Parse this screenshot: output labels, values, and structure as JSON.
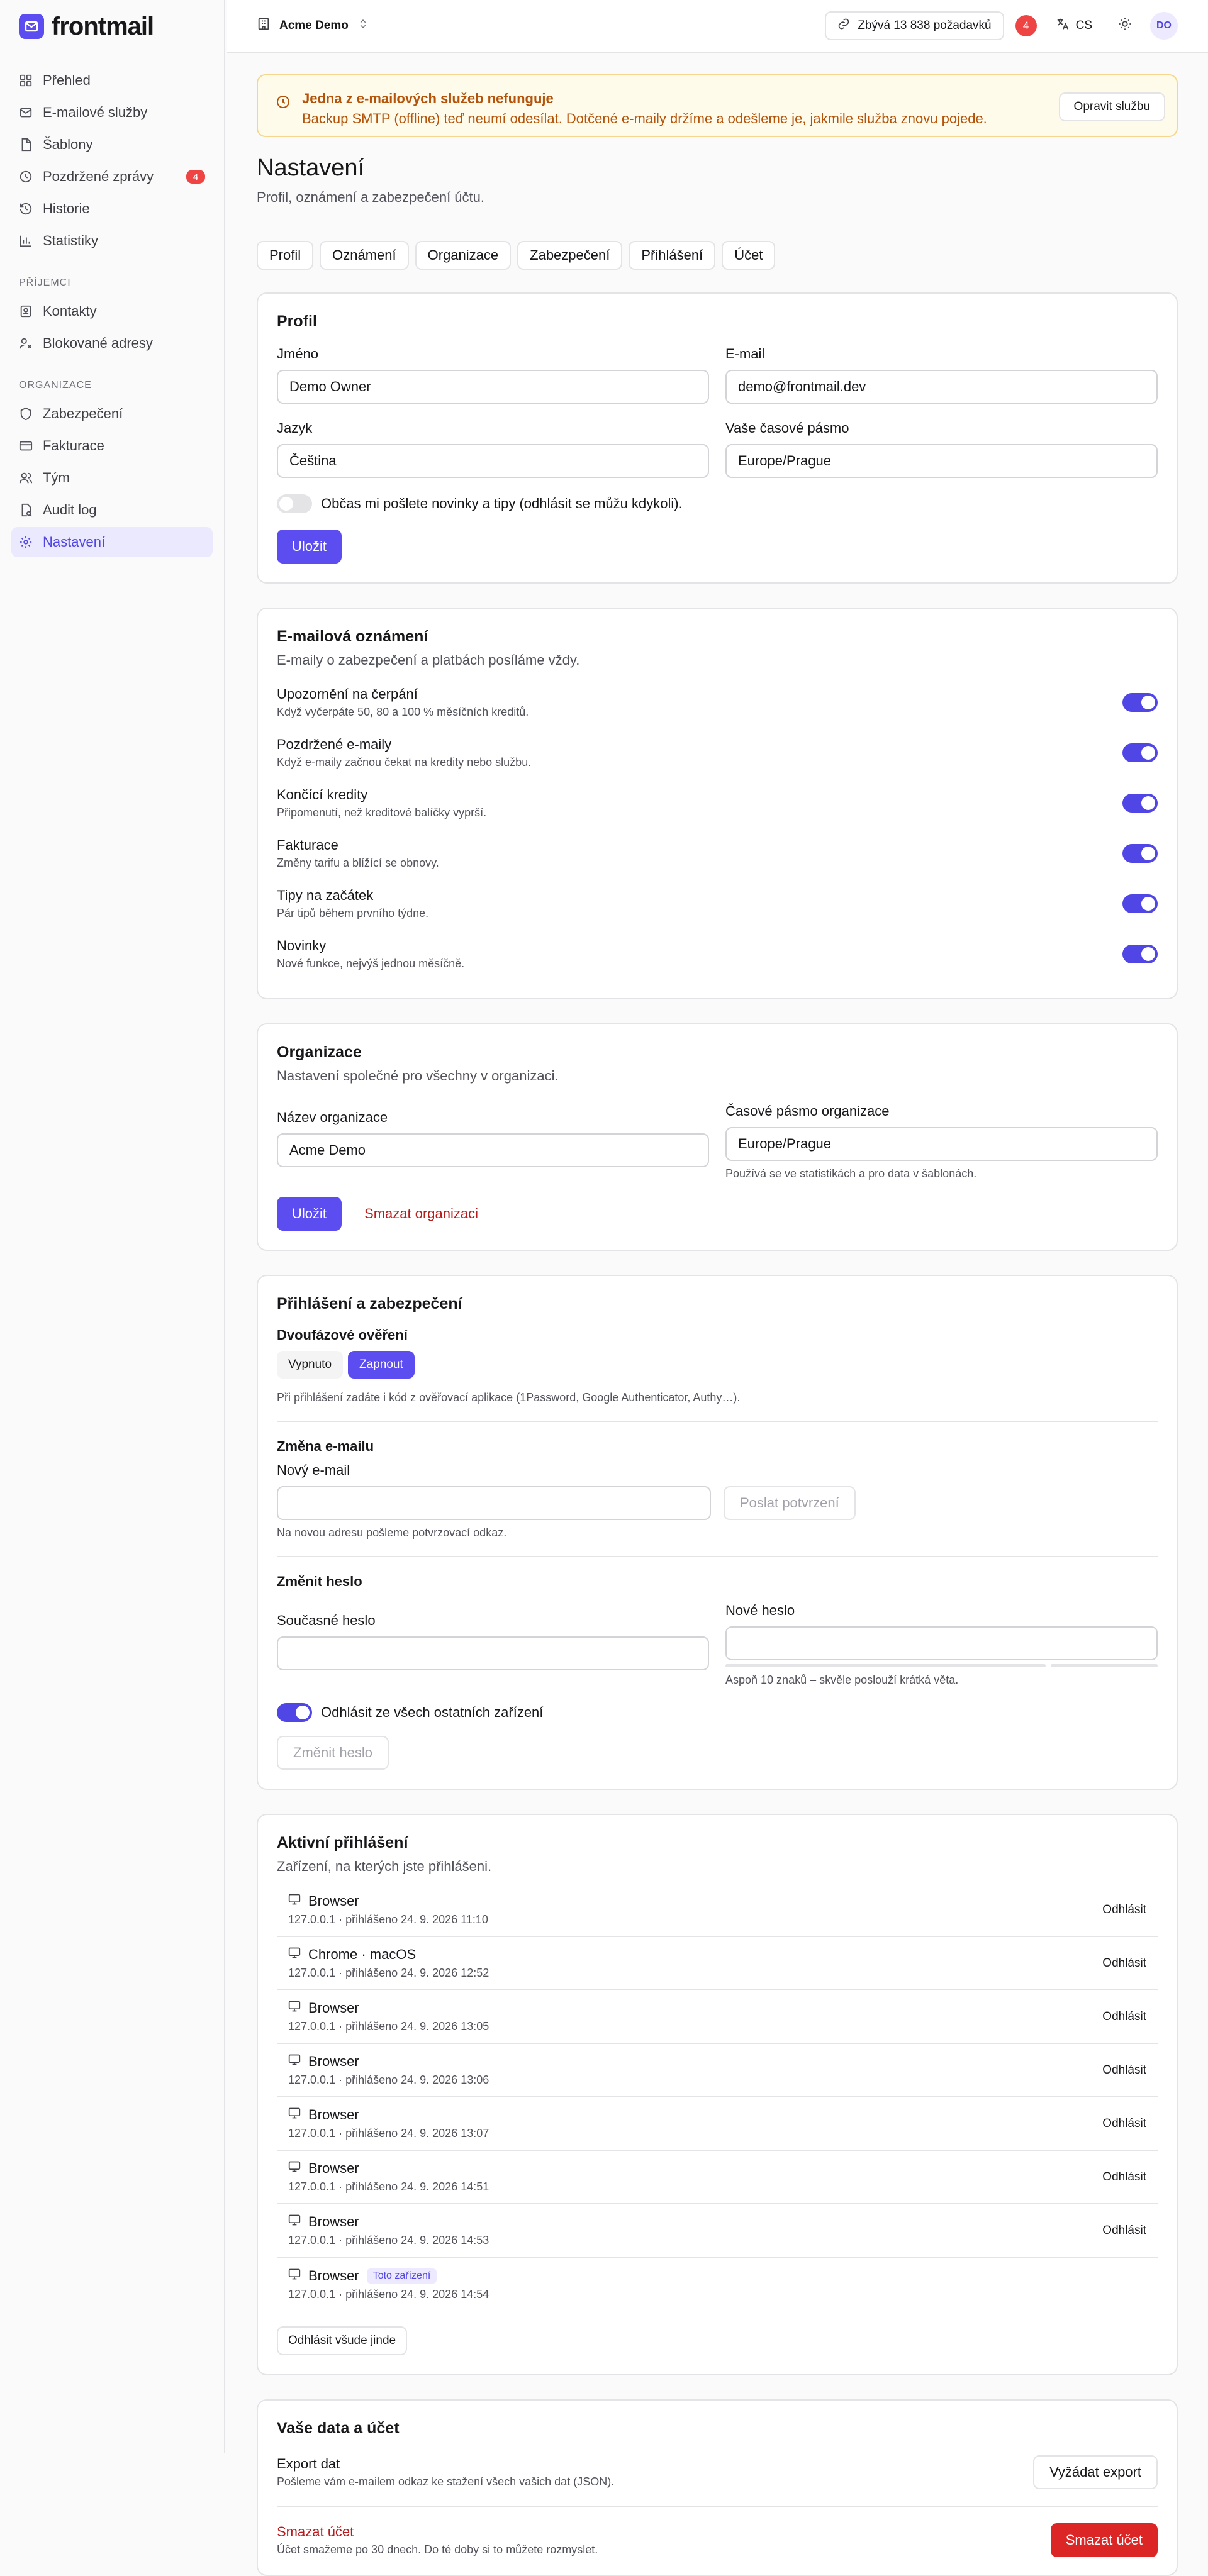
{
  "brand": {
    "name": "frontmail",
    "accent": "#5b4df0"
  },
  "sidebar": {
    "main": [
      {
        "label": "Přehled",
        "icon": "grid-icon"
      },
      {
        "label": "E-mailové služby",
        "icon": "mail-icon"
      },
      {
        "label": "Šablony",
        "icon": "file-icon"
      },
      {
        "label": "Pozdržené zprávy",
        "icon": "clock-icon",
        "badge": "4"
      },
      {
        "label": "Historie",
        "icon": "history-icon"
      },
      {
        "label": "Statistiky",
        "icon": "chart-icon"
      }
    ],
    "recipients_title": "PŘÍJEMCI",
    "recipients": [
      {
        "label": "Kontakty",
        "icon": "contact-icon"
      },
      {
        "label": "Blokované adresy",
        "icon": "user-block-icon"
      }
    ],
    "org_title": "ORGANIZACE",
    "org": [
      {
        "label": "Zabezpečení",
        "icon": "shield-icon"
      },
      {
        "label": "Fakturace",
        "icon": "card-icon"
      },
      {
        "label": "Tým",
        "icon": "team-icon"
      },
      {
        "label": "Audit log",
        "icon": "audit-icon"
      },
      {
        "label": "Nastavení",
        "icon": "gear-icon",
        "active": true
      }
    ]
  },
  "topbar": {
    "org_name": "Acme Demo",
    "quota": "Zbývá 13 838 požadavků",
    "notif_count": "4",
    "lang": "CS",
    "avatar": "DO"
  },
  "alert": {
    "title": "Jedna z e-mailových služeb nefunguje",
    "text": "Backup SMTP (offline) teď neumí odesílat. Dotčené e-maily držíme a odešleme je, jakmile služba znovu pojede.",
    "button": "Opravit službu"
  },
  "page": {
    "title": "Nastavení",
    "subtitle": "Profil, oznámení a zabezpečení účtu."
  },
  "tabs": [
    "Profil",
    "Oznámení",
    "Organizace",
    "Zabezpečení",
    "Přihlášení",
    "Účet"
  ],
  "profile": {
    "title": "Profil",
    "name_label": "Jméno",
    "name_value": "Demo Owner",
    "email_label": "E-mail",
    "email_value": "demo@frontmail.dev",
    "lang_label": "Jazyk",
    "lang_value": "Čeština",
    "tz_label": "Vaše časové pásmo",
    "tz_value": "Europe/Prague",
    "newsletter": "Občas mi pošlete novinky a tipy (odhlásit se můžu kdykoli).",
    "save": "Uložit"
  },
  "notifications": {
    "title": "E-mailová oznámení",
    "subtitle": "E-maily o zabezpečení a platbách posíláme vždy.",
    "items": [
      {
        "title": "Upozornění na čerpání",
        "desc": "Když vyčerpáte 50, 80 a 100 % měsíčních kreditů."
      },
      {
        "title": "Pozdržené e-maily",
        "desc": "Když e-maily začnou čekat na kredity nebo službu."
      },
      {
        "title": "Končící kredity",
        "desc": "Připomenutí, než kreditové balíčky vyprší."
      },
      {
        "title": "Fakturace",
        "desc": "Změny tarifu a blížící se obnovy."
      },
      {
        "title": "Tipy na začátek",
        "desc": "Pár tipů během prvního týdne."
      },
      {
        "title": "Novinky",
        "desc": "Nové funkce, nejvýš jednou měsíčně."
      }
    ]
  },
  "organization": {
    "title": "Organizace",
    "subtitle": "Nastavení společné pro všechny v organizaci.",
    "name_label": "Název organizace",
    "name_value": "Acme Demo",
    "tz_label": "Časové pásmo organizace",
    "tz_value": "Europe/Prague",
    "tz_hint": "Používá se ve statistikách a pro data v šablonách.",
    "save": "Uložit",
    "delete": "Smazat organizaci"
  },
  "security": {
    "title": "Přihlášení a zabezpečení",
    "twofa_label": "Dvoufázové ověření",
    "twofa_off": "Vypnuto",
    "twofa_on": "Zapnout",
    "twofa_hint": "Při přihlášení zadáte i kód z ověřovací aplikace (1Password, Google Authenticator, Authy…).",
    "email_section": "Změna e-mailu",
    "new_email_label": "Nový e-mail",
    "send_confirm": "Poslat potvrzení",
    "email_hint": "Na novou adresu pošleme potvrzovací odkaz.",
    "pw_section": "Změnit heslo",
    "current_pw": "Současné heslo",
    "new_pw": "Nové heslo",
    "pw_hint": "Aspoň 10 znaků – skvěle poslouží krátká věta.",
    "logout_others": "Odhlásit ze všech ostatních zařízení",
    "change_pw": "Změnit heslo"
  },
  "sessions": {
    "title": "Aktivní přihlášení",
    "subtitle": "Zařízení, na kterých jste přihlášeni.",
    "logout": "Odhlásit",
    "this_device": "Toto zařízení",
    "items": [
      {
        "name": "Browser",
        "meta": "127.0.0.1 · přihlášeno 24. 9. 2026 11:10"
      },
      {
        "name": "Chrome · macOS",
        "meta": "127.0.0.1 · přihlášeno 24. 9. 2026 12:52"
      },
      {
        "name": "Browser",
        "meta": "127.0.0.1 · přihlášeno 24. 9. 2026 13:05"
      },
      {
        "name": "Browser",
        "meta": "127.0.0.1 · přihlášeno 24. 9. 2026 13:06"
      },
      {
        "name": "Browser",
        "meta": "127.0.0.1 · přihlášeno 24. 9. 2026 13:07"
      },
      {
        "name": "Browser",
        "meta": "127.0.0.1 · přihlášeno 24. 9. 2026 14:51"
      },
      {
        "name": "Browser",
        "meta": "127.0.0.1 · přihlášeno 24. 9. 2026 14:53"
      },
      {
        "name": "Browser",
        "meta": "127.0.0.1 · přihlášeno 24. 9. 2026 14:54"
      }
    ],
    "logout_all": "Odhlásit všude jinde"
  },
  "account": {
    "title": "Vaše data a účet",
    "export_title": "Export dat",
    "export_desc": "Pošleme vám e-mailem odkaz ke stažení všech vašich dat (JSON).",
    "export_btn": "Vyžádat export",
    "delete_title": "Smazat účet",
    "delete_desc": "Účet smažeme po 30 dnech. Do té doby si to můžete rozmyslet.",
    "delete_btn": "Smazat účet"
  }
}
